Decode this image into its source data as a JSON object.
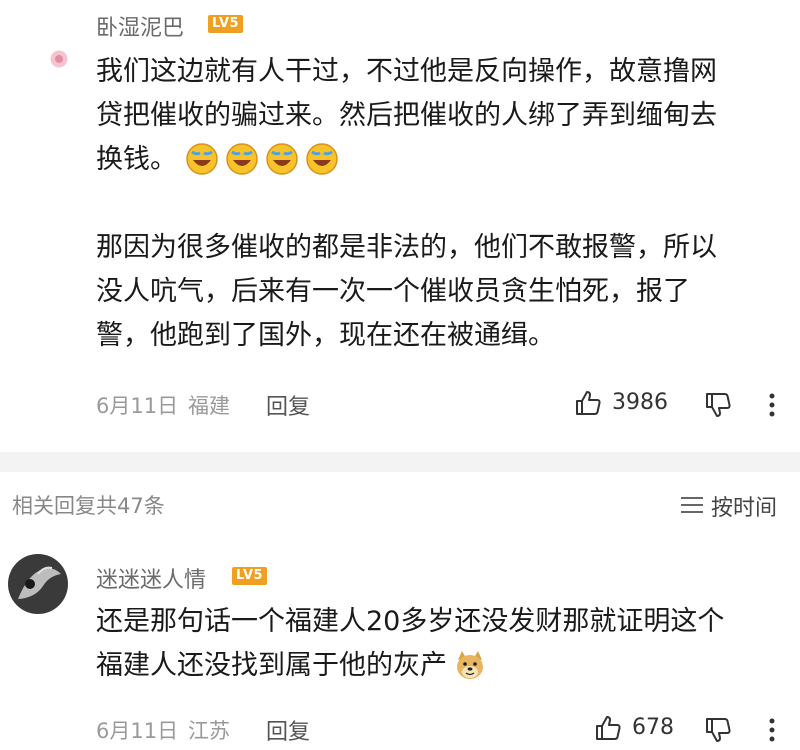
{
  "comment1": {
    "username": "卧湿泥巴",
    "level": "LV5",
    "lines": [
      "我们这边就有人干过，不过他是反向操作，故意撸网",
      "贷把催收的骗过来。然后把催收的人绑了弄到缅甸去",
      "换钱。"
    ],
    "lines2": [
      "那因为很多催收的都是非法的，他们不敢报警，所以",
      "没人吭气，后来有一次一个催收员贪生怕死，报了",
      "警，他跑到了国外，现在还在被通缉。"
    ],
    "date": "6月11日",
    "location": "福建",
    "reply_label": "回复",
    "likes": "3986"
  },
  "replies_header": {
    "label": "相关回复共47条",
    "sort_label": "按时间"
  },
  "comment2": {
    "username": "迷迷迷人情",
    "level": "LV5",
    "lines": [
      "还是那句话一个福建人20多岁还没发财那就证明这个",
      "福建人还没找到属于他的灰产"
    ],
    "date": "6月11日",
    "location": "江苏",
    "reply_label": "回复",
    "likes": "678"
  }
}
